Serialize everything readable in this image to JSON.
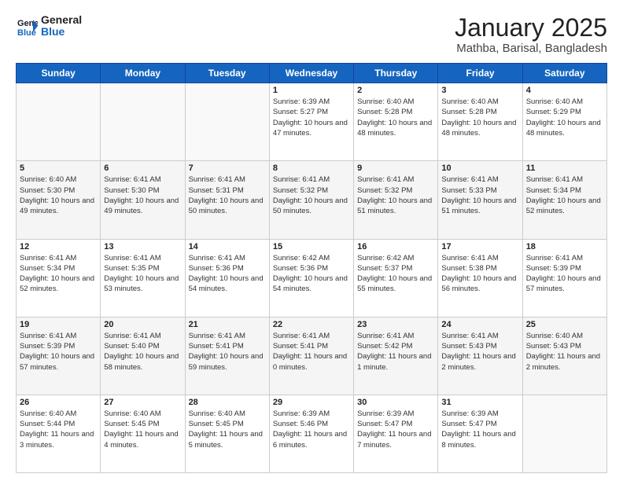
{
  "logo": {
    "line1": "General",
    "line2": "Blue"
  },
  "title": "January 2025",
  "subtitle": "Mathba, Barisal, Bangladesh",
  "headers": [
    "Sunday",
    "Monday",
    "Tuesday",
    "Wednesday",
    "Thursday",
    "Friday",
    "Saturday"
  ],
  "weeks": [
    [
      {
        "day": "",
        "info": ""
      },
      {
        "day": "",
        "info": ""
      },
      {
        "day": "",
        "info": ""
      },
      {
        "day": "1",
        "info": "Sunrise: 6:39 AM\nSunset: 5:27 PM\nDaylight: 10 hours\nand 47 minutes."
      },
      {
        "day": "2",
        "info": "Sunrise: 6:40 AM\nSunset: 5:28 PM\nDaylight: 10 hours\nand 48 minutes."
      },
      {
        "day": "3",
        "info": "Sunrise: 6:40 AM\nSunset: 5:28 PM\nDaylight: 10 hours\nand 48 minutes."
      },
      {
        "day": "4",
        "info": "Sunrise: 6:40 AM\nSunset: 5:29 PM\nDaylight: 10 hours\nand 48 minutes."
      }
    ],
    [
      {
        "day": "5",
        "info": "Sunrise: 6:40 AM\nSunset: 5:30 PM\nDaylight: 10 hours\nand 49 minutes."
      },
      {
        "day": "6",
        "info": "Sunrise: 6:41 AM\nSunset: 5:30 PM\nDaylight: 10 hours\nand 49 minutes."
      },
      {
        "day": "7",
        "info": "Sunrise: 6:41 AM\nSunset: 5:31 PM\nDaylight: 10 hours\nand 50 minutes."
      },
      {
        "day": "8",
        "info": "Sunrise: 6:41 AM\nSunset: 5:32 PM\nDaylight: 10 hours\nand 50 minutes."
      },
      {
        "day": "9",
        "info": "Sunrise: 6:41 AM\nSunset: 5:32 PM\nDaylight: 10 hours\nand 51 minutes."
      },
      {
        "day": "10",
        "info": "Sunrise: 6:41 AM\nSunset: 5:33 PM\nDaylight: 10 hours\nand 51 minutes."
      },
      {
        "day": "11",
        "info": "Sunrise: 6:41 AM\nSunset: 5:34 PM\nDaylight: 10 hours\nand 52 minutes."
      }
    ],
    [
      {
        "day": "12",
        "info": "Sunrise: 6:41 AM\nSunset: 5:34 PM\nDaylight: 10 hours\nand 52 minutes."
      },
      {
        "day": "13",
        "info": "Sunrise: 6:41 AM\nSunset: 5:35 PM\nDaylight: 10 hours\nand 53 minutes."
      },
      {
        "day": "14",
        "info": "Sunrise: 6:41 AM\nSunset: 5:36 PM\nDaylight: 10 hours\nand 54 minutes."
      },
      {
        "day": "15",
        "info": "Sunrise: 6:42 AM\nSunset: 5:36 PM\nDaylight: 10 hours\nand 54 minutes."
      },
      {
        "day": "16",
        "info": "Sunrise: 6:42 AM\nSunset: 5:37 PM\nDaylight: 10 hours\nand 55 minutes."
      },
      {
        "day": "17",
        "info": "Sunrise: 6:41 AM\nSunset: 5:38 PM\nDaylight: 10 hours\nand 56 minutes."
      },
      {
        "day": "18",
        "info": "Sunrise: 6:41 AM\nSunset: 5:39 PM\nDaylight: 10 hours\nand 57 minutes."
      }
    ],
    [
      {
        "day": "19",
        "info": "Sunrise: 6:41 AM\nSunset: 5:39 PM\nDaylight: 10 hours\nand 57 minutes."
      },
      {
        "day": "20",
        "info": "Sunrise: 6:41 AM\nSunset: 5:40 PM\nDaylight: 10 hours\nand 58 minutes."
      },
      {
        "day": "21",
        "info": "Sunrise: 6:41 AM\nSunset: 5:41 PM\nDaylight: 10 hours\nand 59 minutes."
      },
      {
        "day": "22",
        "info": "Sunrise: 6:41 AM\nSunset: 5:41 PM\nDaylight: 11 hours\nand 0 minutes."
      },
      {
        "day": "23",
        "info": "Sunrise: 6:41 AM\nSunset: 5:42 PM\nDaylight: 11 hours\nand 1 minute."
      },
      {
        "day": "24",
        "info": "Sunrise: 6:41 AM\nSunset: 5:43 PM\nDaylight: 11 hours\nand 2 minutes."
      },
      {
        "day": "25",
        "info": "Sunrise: 6:40 AM\nSunset: 5:43 PM\nDaylight: 11 hours\nand 2 minutes."
      }
    ],
    [
      {
        "day": "26",
        "info": "Sunrise: 6:40 AM\nSunset: 5:44 PM\nDaylight: 11 hours\nand 3 minutes."
      },
      {
        "day": "27",
        "info": "Sunrise: 6:40 AM\nSunset: 5:45 PM\nDaylight: 11 hours\nand 4 minutes."
      },
      {
        "day": "28",
        "info": "Sunrise: 6:40 AM\nSunset: 5:45 PM\nDaylight: 11 hours\nand 5 minutes."
      },
      {
        "day": "29",
        "info": "Sunrise: 6:39 AM\nSunset: 5:46 PM\nDaylight: 11 hours\nand 6 minutes."
      },
      {
        "day": "30",
        "info": "Sunrise: 6:39 AM\nSunset: 5:47 PM\nDaylight: 11 hours\nand 7 minutes."
      },
      {
        "day": "31",
        "info": "Sunrise: 6:39 AM\nSunset: 5:47 PM\nDaylight: 11 hours\nand 8 minutes."
      },
      {
        "day": "",
        "info": ""
      }
    ]
  ]
}
